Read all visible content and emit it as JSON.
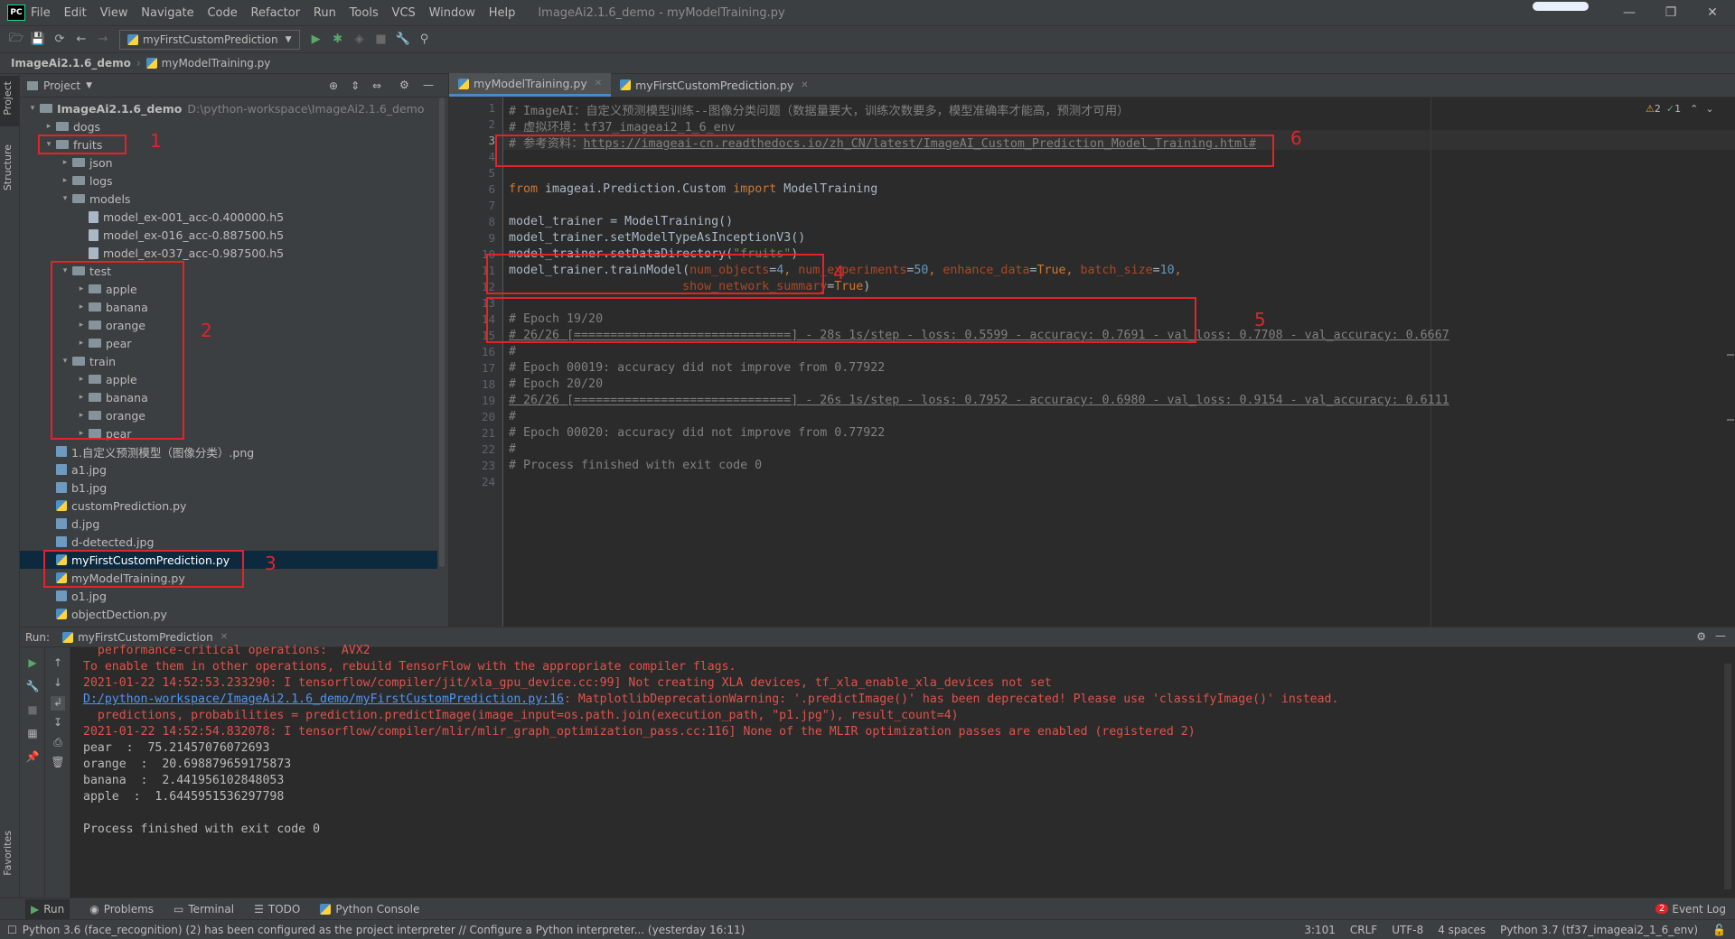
{
  "window": {
    "app_logo": "PC",
    "title": "ImageAi2.1.6_demo - myModelTraining.py",
    "menu": [
      "File",
      "Edit",
      "View",
      "Navigate",
      "Code",
      "Refactor",
      "Run",
      "Tools",
      "VCS",
      "Window",
      "Help"
    ]
  },
  "toolbar": {
    "run_config": "myFirstCustomPrediction"
  },
  "breadcrumb": {
    "project": "ImageAi2.1.6_demo",
    "file": "myModelTraining.py"
  },
  "side_tabs": {
    "project": "Project",
    "structure": "Structure",
    "favorites": "Favorites"
  },
  "project_panel": {
    "header": "Project",
    "tree": [
      {
        "label": "ImageAi2.1.6_demo",
        "path": "D:\\python-workspace\\ImageAi2.1.6_demo",
        "kind": "folder",
        "depth": 0,
        "expanded": true
      },
      {
        "label": "dogs",
        "kind": "folder",
        "depth": 1,
        "expanded": false
      },
      {
        "label": "fruits",
        "kind": "folder",
        "depth": 1,
        "expanded": true
      },
      {
        "label": "json",
        "kind": "folder",
        "depth": 2,
        "expanded": false
      },
      {
        "label": "logs",
        "kind": "folder",
        "depth": 2,
        "expanded": false
      },
      {
        "label": "models",
        "kind": "folder",
        "depth": 2,
        "expanded": true
      },
      {
        "label": "model_ex-001_acc-0.400000.h5",
        "kind": "file",
        "depth": 3
      },
      {
        "label": "model_ex-016_acc-0.887500.h5",
        "kind": "file",
        "depth": 3
      },
      {
        "label": "model_ex-037_acc-0.987500.h5",
        "kind": "file",
        "depth": 3
      },
      {
        "label": "test",
        "kind": "folder",
        "depth": 2,
        "expanded": true
      },
      {
        "label": "apple",
        "kind": "folder",
        "depth": 3,
        "expanded": false
      },
      {
        "label": "banana",
        "kind": "folder",
        "depth": 3,
        "expanded": false
      },
      {
        "label": "orange",
        "kind": "folder",
        "depth": 3,
        "expanded": false
      },
      {
        "label": "pear",
        "kind": "folder",
        "depth": 3,
        "expanded": false
      },
      {
        "label": "train",
        "kind": "folder",
        "depth": 2,
        "expanded": true
      },
      {
        "label": "apple",
        "kind": "folder",
        "depth": 3,
        "expanded": false
      },
      {
        "label": "banana",
        "kind": "folder",
        "depth": 3,
        "expanded": false
      },
      {
        "label": "orange",
        "kind": "folder",
        "depth": 3,
        "expanded": false
      },
      {
        "label": "pear",
        "kind": "folder",
        "depth": 3,
        "expanded": false
      },
      {
        "label": "1.自定义预测模型（图像分类）.png",
        "kind": "image",
        "depth": 1
      },
      {
        "label": "a1.jpg",
        "kind": "image",
        "depth": 1
      },
      {
        "label": "b1.jpg",
        "kind": "image",
        "depth": 1
      },
      {
        "label": "customPrediction.py",
        "kind": "python",
        "depth": 1
      },
      {
        "label": "d.jpg",
        "kind": "image",
        "depth": 1
      },
      {
        "label": "d-detected.jpg",
        "kind": "image",
        "depth": 1
      },
      {
        "label": "myFirstCustomPrediction.py",
        "kind": "python",
        "depth": 1,
        "selected": true
      },
      {
        "label": "myModelTraining.py",
        "kind": "python",
        "depth": 1
      },
      {
        "label": "o1.jpg",
        "kind": "image",
        "depth": 1
      },
      {
        "label": "objectDection.py",
        "kind": "python",
        "depth": 1
      }
    ]
  },
  "annotations": [
    "1",
    "2",
    "3",
    "4",
    "5",
    "6"
  ],
  "editor": {
    "tabs": [
      "myModelTraining.py",
      "myFirstCustomPrediction.py"
    ],
    "inspections": {
      "warnings": "2",
      "weak_warnings": "1"
    },
    "line_numbers": [
      "1",
      "2",
      "3",
      "4",
      "5",
      "6",
      "7",
      "8",
      "9",
      "10",
      "11",
      "12",
      "13",
      "14",
      "15",
      "16",
      "17",
      "18",
      "19",
      "20",
      "21",
      "22",
      "23",
      "24"
    ],
    "lines": {
      "l1": "# ImageAI：自定义预测模型训练--图像分类问题（数据量要大，训练次数要多，模型准确率才能高，预测才可用）",
      "l2": "# 虚拟环境：tf37_imageai2_1_6_env",
      "l3_prefix": "# 参考资料：",
      "l3_link": "https://imageai-cn.readthedocs.io/zh_CN/latest/ImageAI_Custom_Prediction_Model_Training.html#",
      "l6_from": "from",
      "l6_module": " imageai.Prediction.Custom ",
      "l6_import": "import",
      "l6_name": " ModelTraining",
      "l8": "model_trainer = ModelTraining()",
      "l9": "model_trainer.setModelTypeAsInceptionV3()",
      "l10_a": "model_trainer.setDataDirectory(",
      "l10_str": "\"fruits\"",
      "l10_b": ")",
      "l11_a": "model_trainer.trainModel(",
      "l11_p1": "num_objects",
      "l11_v1": "4",
      "l11_p2": "num_experiments",
      "l11_v2": "50",
      "l11_p3": "enhance_data",
      "l11_v3": "True",
      "l11_p4": "batch_size",
      "l11_v4": "10",
      "l12_p": "show_network_summary",
      "l12_v": "True",
      "l14": "# Epoch 19/20",
      "l15": "# 26/26 [==============================] - 28s 1s/step - loss: 0.5599 - accuracy: 0.7691 - val_loss: 0.7708 - val_accuracy: 0.6667",
      "l16": "#",
      "l17": "# Epoch 00019: accuracy did not improve from 0.77922",
      "l18": "# Epoch 20/20",
      "l19": "# 26/26 [==============================] - 26s 1s/step - loss: 0.7952 - accuracy: 0.6980 - val_loss: 0.9154 - val_accuracy: 0.6111",
      "l20": "#",
      "l21": "# Epoch 00020: accuracy did not improve from 0.77922",
      "l22": "#",
      "l23": "# Process finished with exit code 0"
    }
  },
  "run_panel": {
    "label": "Run:",
    "tab": "myFirstCustomPrediction",
    "output": {
      "o0": "  performance-critical operations:  AVX2",
      "o1": "To enable them in other operations, rebuild TensorFlow with the appropriate compiler flags.",
      "o2": "2021-01-22 14:52:53.233290: I tensorflow/compiler/jit/xla_gpu_device.cc:99] Not creating XLA devices, tf_xla_enable_xla_devices not set",
      "o3_link": "D:/python-workspace/ImageAi2.1.6_demo/myFirstCustomPrediction.py:16",
      "o3_rest": ": MatplotlibDeprecationWarning: '.predictImage()' has been deprecated! Please use 'classifyImage()' instead.",
      "o4": "  predictions, probabilities = prediction.predictImage(image_input=os.path.join(execution_path, \"p1.jpg\"), result_count=4)",
      "o5": "2021-01-22 14:52:54.832078: I tensorflow/compiler/mlir/mlir_graph_optimization_pass.cc:116] None of the MLIR optimization passes are enabled (registered 2)",
      "o6": "pear  :  75.21457076072693",
      "o7": "orange  :  20.698879659175873",
      "o8": "banana  :  2.441956102848053",
      "o9": "apple  :  1.6445951536297798",
      "o10": "Process finished with exit code 0"
    }
  },
  "bottom_tabs": [
    "Run",
    "Problems",
    "Terminal",
    "TODO",
    "Python Console"
  ],
  "event_log": {
    "count": "2",
    "label": "Event Log"
  },
  "status_bar": {
    "message": "Python 3.6 (face_recognition) (2) has been configured as the project interpreter // Configure a Python interpreter... (yesterday 16:11)",
    "position": "3:101",
    "line_sep": "CRLF",
    "encoding": "UTF-8",
    "indent": "4 spaces",
    "interpreter": "Python 3.7 (tf37_imageai2_1_6_env)"
  },
  "colors": {
    "bg_dark": "#2b2b2b",
    "panel": "#3c3f41",
    "selection": "#0d293e",
    "annotation_red": "#e0242a",
    "error_text": "#e0524a",
    "keyword": "#cc7832",
    "string": "#6a8759",
    "number": "#6897bb",
    "comment": "#808080"
  }
}
